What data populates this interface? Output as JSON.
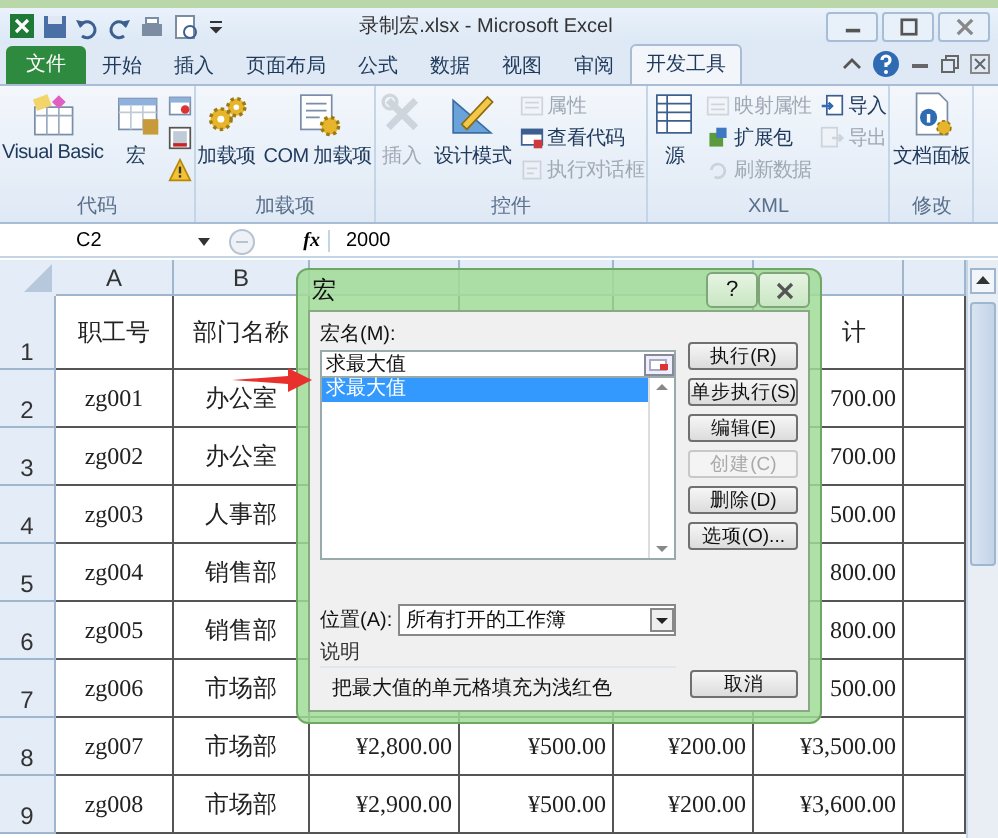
{
  "window": {
    "title": "录制宏.xlsx - Microsoft Excel"
  },
  "tabs": [
    {
      "label": "文件",
      "selected": false,
      "kind": "file"
    },
    {
      "label": "开始",
      "selected": false,
      "kind": "tab"
    },
    {
      "label": "插入",
      "selected": false,
      "kind": "tab"
    },
    {
      "label": "页面布局",
      "selected": false,
      "kind": "tab"
    },
    {
      "label": "公式",
      "selected": false,
      "kind": "tab"
    },
    {
      "label": "数据",
      "selected": false,
      "kind": "tab"
    },
    {
      "label": "视图",
      "selected": false,
      "kind": "tab"
    },
    {
      "label": "审阅",
      "selected": false,
      "kind": "tab"
    },
    {
      "label": "开发工具",
      "selected": true,
      "kind": "tab"
    }
  ],
  "ribbon_groups": [
    {
      "label": "代码",
      "items": [
        {
          "kind": "large",
          "label": "Visual Basic",
          "disabled": false
        },
        {
          "kind": "large",
          "label": "宏",
          "disabled": false
        },
        {
          "kind": "icon",
          "disabled": false
        },
        {
          "kind": "icon",
          "disabled": false
        },
        {
          "kind": "icon",
          "disabled": false
        }
      ]
    },
    {
      "label": "加载项",
      "items": [
        {
          "kind": "large",
          "label": "加载项",
          "disabled": false
        },
        {
          "kind": "large",
          "label": "COM 加载项",
          "disabled": false
        }
      ]
    },
    {
      "label": "控件",
      "items": [
        {
          "kind": "large",
          "label": "插入",
          "disabled": true
        },
        {
          "kind": "large",
          "label": "设计模式",
          "disabled": false
        },
        {
          "kind": "small",
          "label": "属性",
          "disabled": true
        },
        {
          "kind": "small",
          "label": "查看代码",
          "disabled": false
        },
        {
          "kind": "small",
          "label": "执行对话框",
          "disabled": true
        }
      ]
    },
    {
      "label": "XML",
      "items": [
        {
          "kind": "large",
          "label": "源",
          "disabled": false
        },
        {
          "kind": "small",
          "label": "映射属性",
          "disabled": true
        },
        {
          "kind": "small",
          "label": "扩展包",
          "disabled": false
        },
        {
          "kind": "small",
          "label": "刷新数据",
          "disabled": true
        },
        {
          "kind": "small",
          "label": "导入",
          "disabled": false
        },
        {
          "kind": "small",
          "label": "导出",
          "disabled": true
        }
      ]
    },
    {
      "label": "修改",
      "items": [
        {
          "kind": "large",
          "label": "文档面板",
          "disabled": false
        }
      ]
    }
  ],
  "formula_bar": {
    "name_box": "C2",
    "fx": "fx",
    "value": "2000"
  },
  "sheet": {
    "columns": [
      "A",
      "B"
    ],
    "rows": [
      {
        "number": "1",
        "cells": {
          "A": "职工号",
          "B": "部门名称",
          "F": "计"
        }
      },
      {
        "number": "2",
        "cells": {
          "A": "zg001",
          "B": "办公室",
          "F": "700.00"
        }
      },
      {
        "number": "3",
        "cells": {
          "A": "zg002",
          "B": "办公室",
          "F": "700.00"
        }
      },
      {
        "number": "4",
        "cells": {
          "A": "zg003",
          "B": "人事部",
          "F": "500.00"
        }
      },
      {
        "number": "5",
        "cells": {
          "A": "zg004",
          "B": "销售部",
          "F": "800.00"
        }
      },
      {
        "number": "6",
        "cells": {
          "A": "zg005",
          "B": "销售部",
          "F": "800.00"
        }
      },
      {
        "number": "7",
        "cells": {
          "A": "zg006",
          "B": "市场部",
          "F": "500.00"
        }
      },
      {
        "number": "8",
        "cells": {
          "A": "zg007",
          "B": "市场部",
          "C": "¥2,800.00",
          "D": "¥500.00",
          "E": "¥200.00",
          "F": "¥3,500.00"
        }
      },
      {
        "number": "9",
        "cells": {
          "A": "zg008",
          "B": "市场部",
          "C": "¥2,900.00",
          "D": "¥500.00",
          "E": "¥200.00",
          "F": "¥3,600.00"
        }
      }
    ]
  },
  "dialog": {
    "title": "宏",
    "help": "?",
    "name_label": "宏名(M):",
    "name_value": "求最大值",
    "macros": [
      {
        "name": "求最大值",
        "selected": true
      }
    ],
    "location_label": "位置(A):",
    "location_value": "所有打开的工作簿",
    "description_label": "说明",
    "description": "把最大值的单元格填充为浅红色",
    "buttons": [
      {
        "label": "执行(R)",
        "disabled": false
      },
      {
        "label": "单步执行(S)",
        "disabled": false
      },
      {
        "label": "编辑(E)",
        "disabled": false
      },
      {
        "label": "创建(C)",
        "disabled": true
      },
      {
        "label": "删除(D)",
        "disabled": false
      },
      {
        "label": "选项(O)...",
        "disabled": false
      }
    ],
    "cancel": "取消"
  }
}
